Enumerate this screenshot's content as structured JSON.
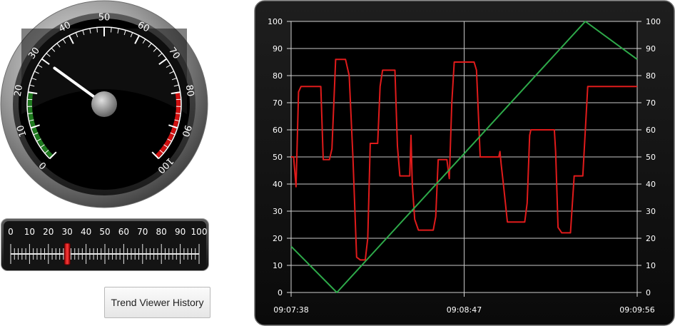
{
  "gauge": {
    "needle_value": 30,
    "scale_labels": [
      "0",
      "10",
      "20",
      "30",
      "40",
      "50",
      "60",
      "70",
      "80",
      "90",
      "100"
    ],
    "low_band": [
      0,
      20
    ],
    "high_band": [
      80,
      100
    ],
    "colors": {
      "low_band": "#1f7a1f",
      "high_band": "#d01010",
      "needle": "#ffffff"
    }
  },
  "slider": {
    "value": 30,
    "scale_labels": [
      "0",
      "10",
      "20",
      "30",
      "40",
      "50",
      "60",
      "70",
      "80",
      "90",
      "100"
    ],
    "colors": {
      "thumb": "#e21e1e"
    }
  },
  "button": {
    "label": "Trend Viewer History"
  },
  "chart_data": {
    "type": "line",
    "x_tick_labels": [
      "09:07:38",
      "09:08:47",
      "09:09:56"
    ],
    "ylim": [
      0,
      100
    ],
    "y_ticks": [
      0,
      10,
      20,
      30,
      40,
      50,
      60,
      70,
      80,
      90,
      100
    ],
    "grid": true,
    "colors": {
      "red": "#e01b1b",
      "green": "#2eaa4a",
      "background": "#000000",
      "grid": "#c8c8c8"
    },
    "series": [
      {
        "color": "#e01b1b",
        "points": [
          [
            0,
            50
          ],
          [
            2,
            50
          ],
          [
            4,
            39
          ],
          [
            6,
            74
          ],
          [
            8,
            76
          ],
          [
            24,
            76
          ],
          [
            26,
            49
          ],
          [
            31,
            49
          ],
          [
            33,
            53
          ],
          [
            36,
            86
          ],
          [
            44,
            86
          ],
          [
            47,
            80
          ],
          [
            50,
            50
          ],
          [
            53,
            13
          ],
          [
            56,
            12
          ],
          [
            60,
            12
          ],
          [
            62,
            20
          ],
          [
            64,
            55
          ],
          [
            70,
            55
          ],
          [
            72,
            76
          ],
          [
            74,
            82
          ],
          [
            84,
            82
          ],
          [
            86,
            54
          ],
          [
            88,
            43
          ],
          [
            96,
            43
          ],
          [
            97,
            58
          ],
          [
            98,
            40
          ],
          [
            100,
            27
          ],
          [
            103,
            23
          ],
          [
            115,
            23
          ],
          [
            117,
            28
          ],
          [
            119,
            49
          ],
          [
            126,
            49
          ],
          [
            128,
            42
          ],
          [
            130,
            70
          ],
          [
            132,
            85
          ],
          [
            148,
            85
          ],
          [
            150,
            82
          ],
          [
            153,
            50
          ],
          [
            168,
            50
          ],
          [
            169,
            52
          ],
          [
            170,
            47
          ],
          [
            172,
            39
          ],
          [
            175,
            26
          ],
          [
            189,
            26
          ],
          [
            191,
            33
          ],
          [
            193,
            58
          ],
          [
            194,
            60
          ],
          [
            213,
            60
          ],
          [
            214,
            52
          ],
          [
            216,
            24
          ],
          [
            219,
            22
          ],
          [
            226,
            22
          ],
          [
            229,
            43
          ],
          [
            236,
            43
          ],
          [
            240,
            76
          ],
          [
            280,
            76
          ]
        ]
      },
      {
        "color": "#2eaa4a",
        "points": [
          [
            0,
            17
          ],
          [
            37,
            0
          ],
          [
            238,
            100
          ],
          [
            280,
            86
          ]
        ]
      }
    ]
  }
}
